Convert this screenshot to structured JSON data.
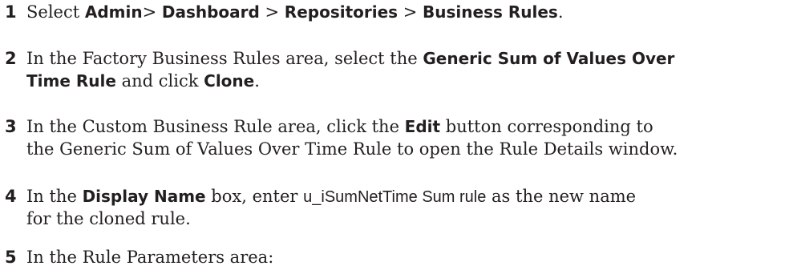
{
  "steps": [
    {
      "number": "1",
      "text": {
        "p1": "Select ",
        "b1": "Admin",
        "p2": "> ",
        "b2": "Dashboard",
        "p3": " > ",
        "b3": "Repositories",
        "p4": " > ",
        "b4": "Business Rules",
        "p5": "."
      }
    },
    {
      "number": "2",
      "line1": {
        "p1": "In the Factory Business Rules area, select the ",
        "b1": "Generic Sum of Values Over"
      },
      "line2": {
        "b1": "Time Rule",
        "p1": " and click ",
        "b2": "Clone",
        "p2": "."
      }
    },
    {
      "number": "3",
      "line1": {
        "p1": "In the Custom Business Rule area, click the ",
        "b1": "Edit",
        "p2": " button  corresponding to"
      },
      "line2": {
        "p1": "the Generic Sum of Values Over Time Rule to open the Rule Details window."
      }
    },
    {
      "number": "4",
      "line1": {
        "p1": "In the ",
        "b1": "Display Name",
        "p2": " box, enter ",
        "m1": "u_iSumNetTime Sum rule",
        "p3": " as the new name"
      },
      "line2": {
        "p1": "for the cloned rule."
      }
    },
    {
      "number": "5",
      "text": {
        "p1": "In the Rule Parameters area:"
      }
    }
  ]
}
